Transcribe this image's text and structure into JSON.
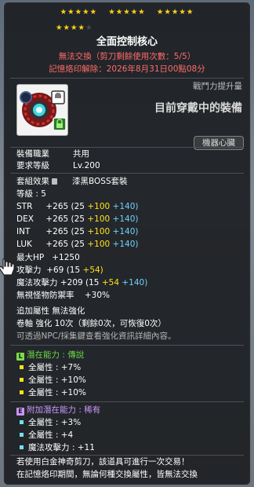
{
  "stars": {
    "row1_filled": 15,
    "row2_filled": 4,
    "row2_empty": 1
  },
  "item": {
    "name": "全面控制核心",
    "trade_notice": "無法交換（剪刀剩餘使用次數：5/5）",
    "seal_notice": "記憶烙印解除：2026年8月31日00點08分",
    "power_label": "戰鬥力提升量",
    "equipped_label": "目前穿戴中的裝備",
    "category": "機器心臟"
  },
  "requirements": {
    "job_label": "裝備職業",
    "job_value": "共用",
    "level_label": "要求等級",
    "level_value": "Lv.200"
  },
  "set_effect": {
    "label": "套組效果",
    "value": "漆黑BOSS套裝"
  },
  "grade": "等級 : 5",
  "stats": [
    {
      "name": "STR",
      "total": "+265",
      "base": "(25",
      "a": "+100",
      "b": "+140)"
    },
    {
      "name": "DEX",
      "total": "+265",
      "base": "(25",
      "a": "+100",
      "b": "+140)"
    },
    {
      "name": "INT",
      "total": "+265",
      "base": "(25",
      "a": "+100",
      "b": "+140)"
    },
    {
      "name": "LUK",
      "total": "+265",
      "base": "(25",
      "a": "+100",
      "b": "+140)"
    }
  ],
  "max_hp": {
    "label": "最大HP",
    "value": "+1250"
  },
  "attack": {
    "label": "攻擊力",
    "total": "+69",
    "base": "(15",
    "a": "+54)"
  },
  "magic_attack": {
    "label": "魔法攻擊力",
    "total": "+209",
    "base": "(15",
    "a": "+54",
    "b": "+140)"
  },
  "ignore_def": {
    "label": "無視怪物防禦率",
    "value": "+30%"
  },
  "extra_attr": "追加屬性 無法強化",
  "scroll": "卷軸 強化 10次（剩餘0次，可恢復0次）",
  "npc_note": "可透過NPC/採集鍵查看強化資訊詳細內容。",
  "potential": {
    "badge": "L",
    "title": "潛在能力 : 傳說",
    "lines": [
      "全屬性 : +7%",
      "全屬性 : +10%",
      "全屬性 : +10%"
    ]
  },
  "additional_potential": {
    "badge": "E",
    "title": "附加潛在能力 : 稀有",
    "lines": [
      "全屬性 : +3%",
      "全屬性 : +4",
      "魔法攻擊力 : +11"
    ]
  },
  "footer": [
    "若使用白金神奇剪刀，該道具可進行一次交易！",
    "在記憶烙印期間，無論何種交換屬性，皆無法交換"
  ],
  "colors": {
    "warn": "#ff6b6b",
    "legend": "#69d84a",
    "epic": "#c997ff",
    "yellow": "#ffe21a",
    "cyan": "#6fd2ff"
  }
}
